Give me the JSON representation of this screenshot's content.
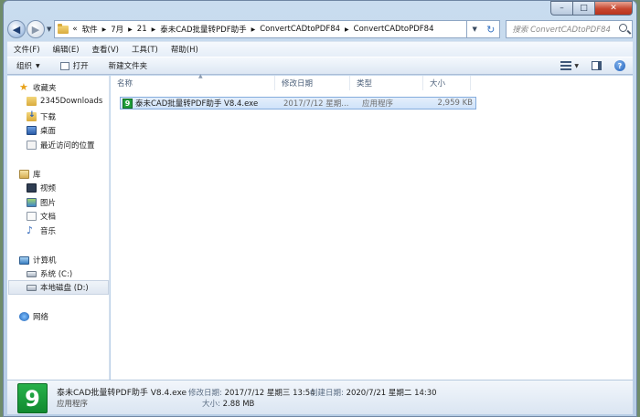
{
  "window": {
    "caption": {
      "minimize": "–",
      "maximize": "□",
      "close": "✕"
    }
  },
  "address": {
    "overflow": "«",
    "crumbs": [
      "软件",
      "7月",
      "21",
      "泰未CAD批量转PDF助手",
      "ConvertCADtoPDF84",
      "ConvertCADtoPDF84"
    ],
    "search_placeholder": "搜索 ConvertCADtoPDF84"
  },
  "menu": [
    "文件(F)",
    "编辑(E)",
    "查看(V)",
    "工具(T)",
    "帮助(H)"
  ],
  "toolbar": {
    "organize": "组织",
    "open": "打开",
    "new_folder": "新建文件夹"
  },
  "nav": {
    "favorites": "收藏夹",
    "favorites_items": [
      "2345Downloads",
      "下载",
      "桌面",
      "最近访问的位置"
    ],
    "library": "库",
    "library_items": [
      "视频",
      "图片",
      "文档",
      "音乐"
    ],
    "computer": "计算机",
    "computer_items": [
      "系统 (C:)",
      "本地磁盘 (D:)"
    ],
    "network": "网络"
  },
  "columns": {
    "name": "名称",
    "modified": "修改日期",
    "type": "类型",
    "size": "大小"
  },
  "files": [
    {
      "name": "泰未CAD批量转PDF助手 V8.4.exe",
      "modified": "2017/7/12 星期...",
      "type": "应用程序",
      "size": "2,959 KB"
    }
  ],
  "details": {
    "name": "泰未CAD批量转PDF助手 V8.4.exe",
    "type": "应用程序",
    "modified_label": "修改日期:",
    "modified_value": "2017/7/12 星期三 13:54",
    "created_label": "创建日期:",
    "created_value": "2020/7/21 星期二 14:30",
    "size_label": "大小:",
    "size_value": "2.88 MB"
  },
  "icons": {
    "app_glyph": "9"
  }
}
